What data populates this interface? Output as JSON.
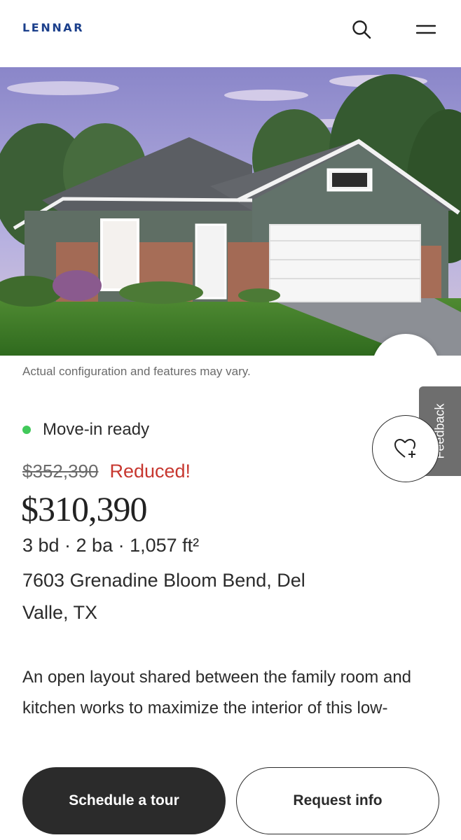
{
  "header": {
    "logo": "LENNAR",
    "icons": [
      "search-icon",
      "hamburger-menu-icon"
    ]
  },
  "hero": {
    "disclaimer": "Actual configuration and features may vary.",
    "gallery_icon": "photo-gallery-icon"
  },
  "feedback": {
    "label": "Feedback"
  },
  "listing": {
    "status": "Move-in ready",
    "status_color": "#41c95a",
    "original_price": "$352,390",
    "reduced_label": "Reduced!",
    "reduced_color": "#c7372f",
    "price": "$310,390",
    "specs": "3 bd · 2 ba · 1,057 ft²",
    "address": "7603 Grenadine Bloom Bend, Del Valle, TX",
    "description": "An open layout shared between the family room and kitchen works to maximize the interior of this low-",
    "favorite_icon": "heart-plus-icon"
  },
  "actions": {
    "schedule_tour": "Schedule a tour",
    "request_info": "Request info"
  },
  "colors": {
    "brand": "#1b3f8b",
    "primary_button": "#2b2b2b",
    "text": "#2b2b2b"
  }
}
